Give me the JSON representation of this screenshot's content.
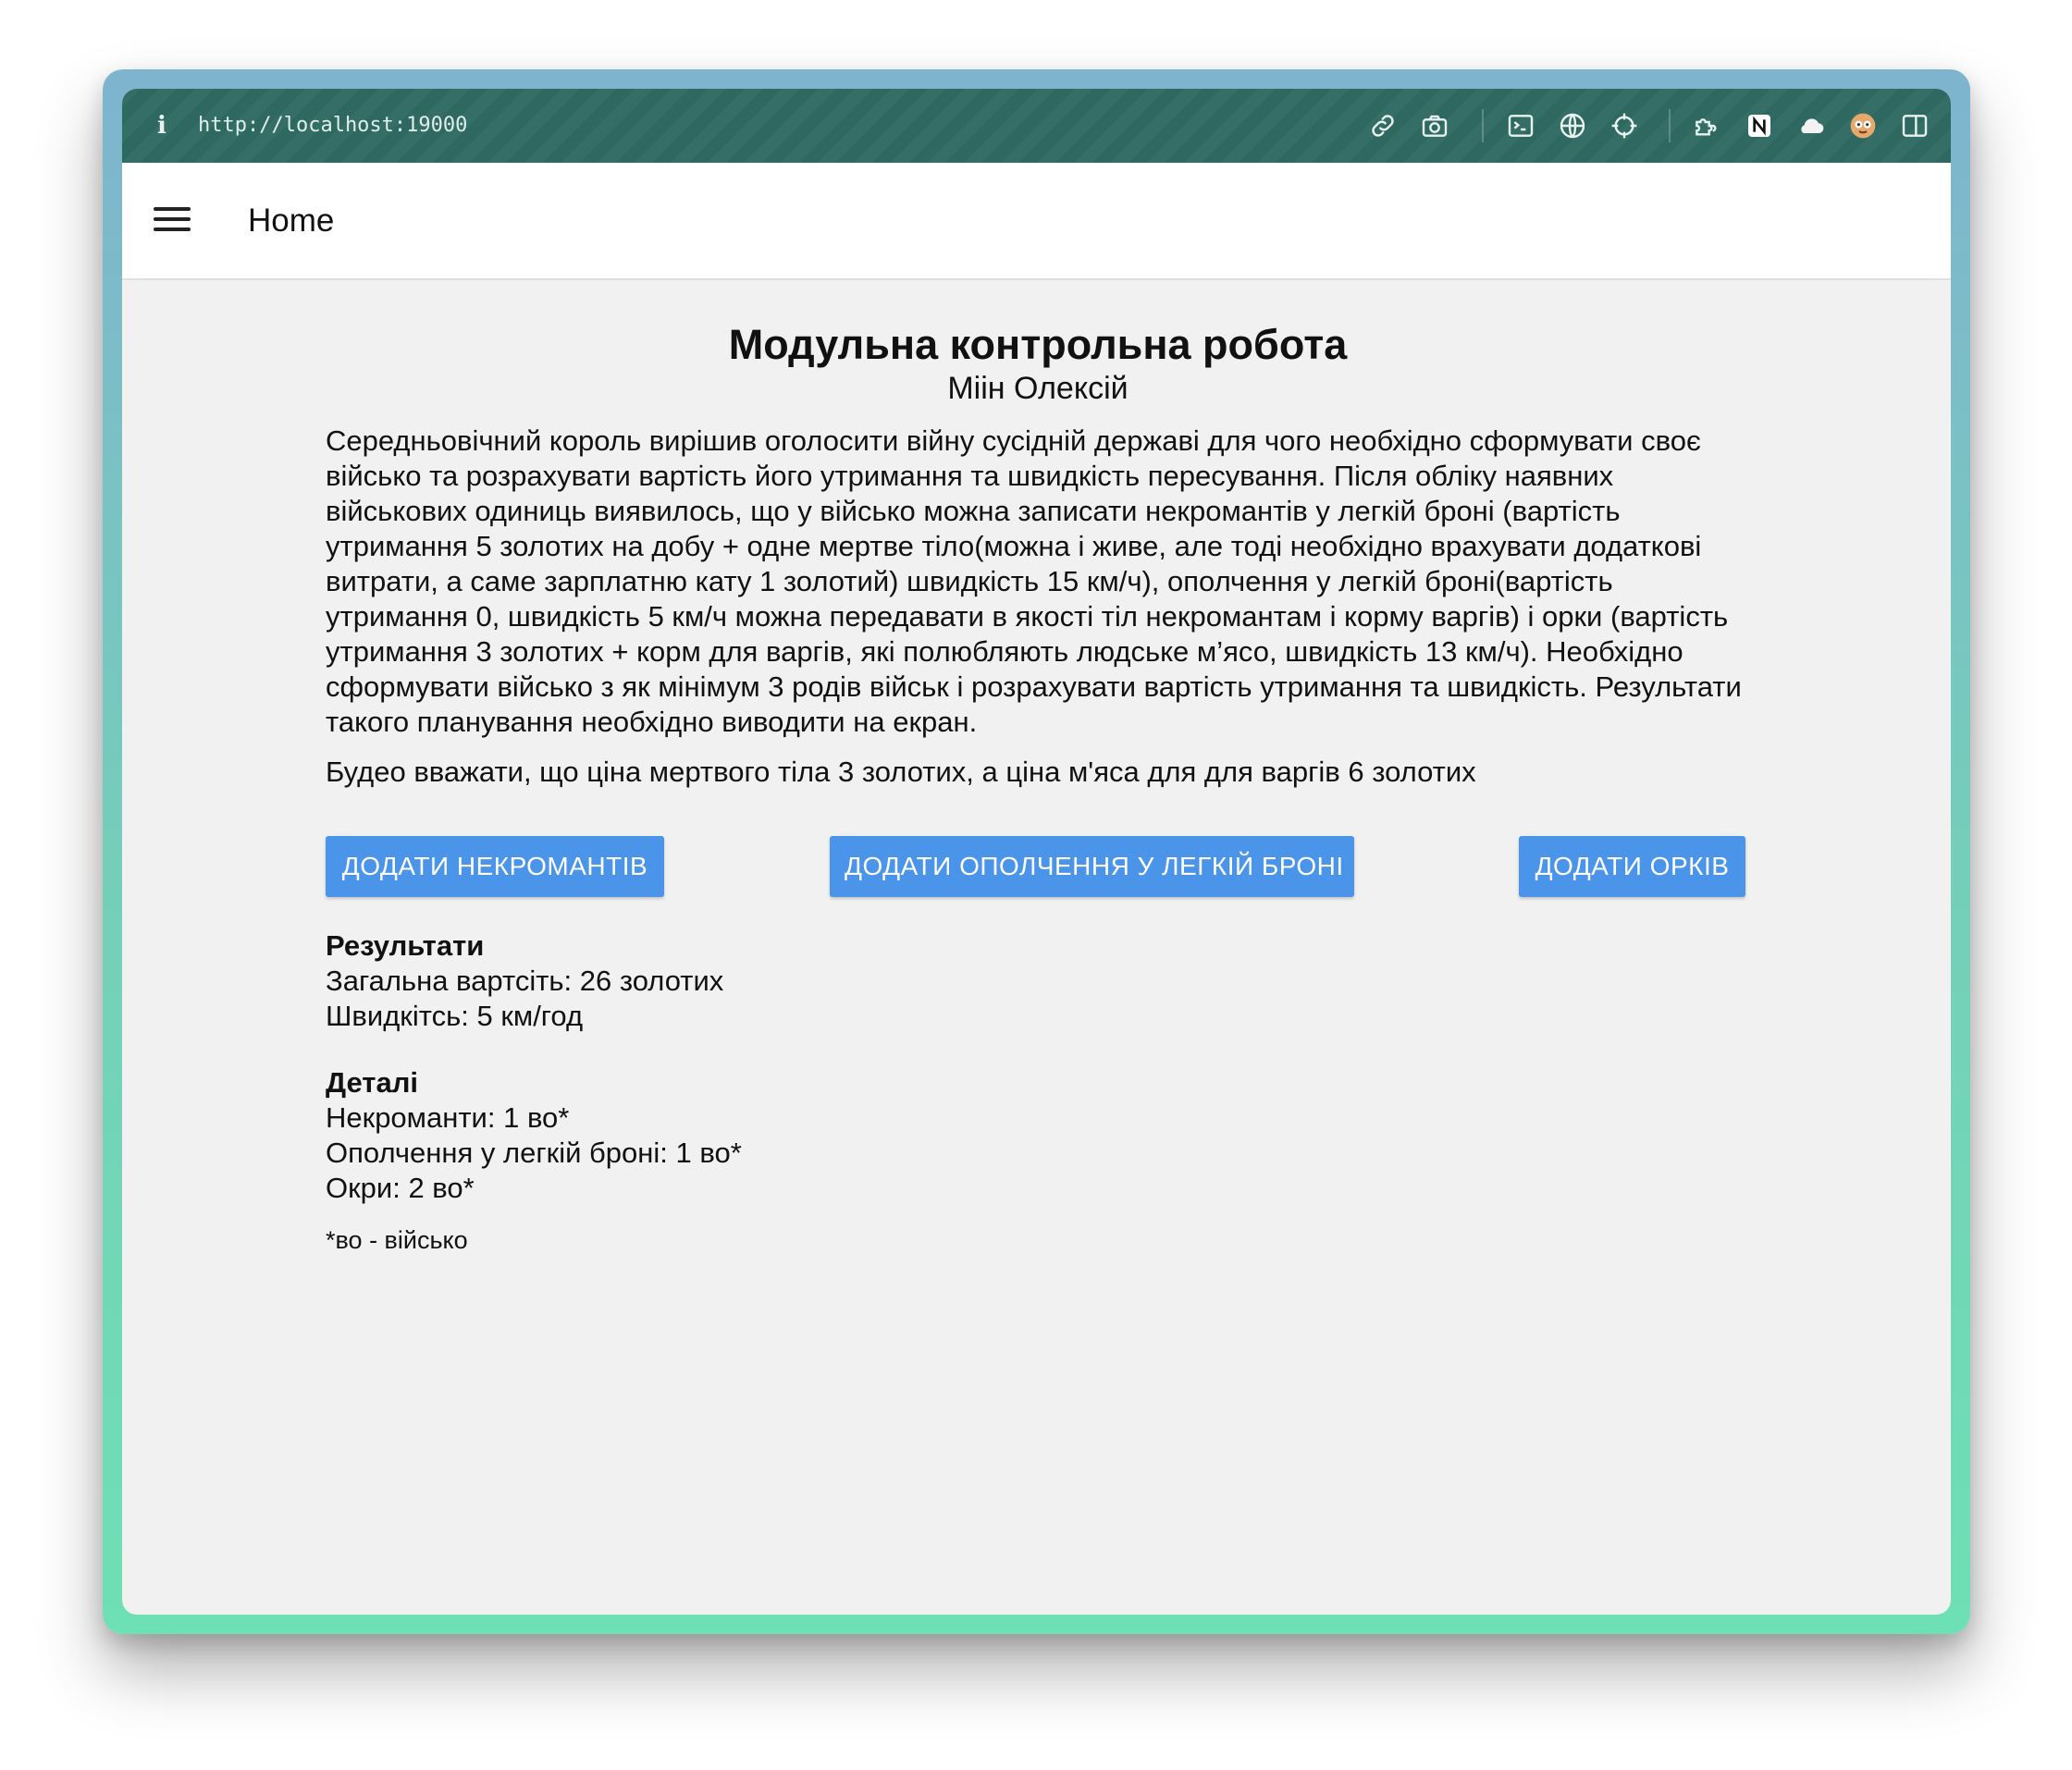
{
  "browser": {
    "url": "http://localhost:19000",
    "icons": [
      "info-icon",
      "link-icon",
      "camera-icon",
      "terminal-icon",
      "globe-icon",
      "crosshair-icon",
      "puzzle-icon",
      "notion-icon",
      "cloud-icon",
      "avatar-icon",
      "sidebar-icon"
    ]
  },
  "appbar": {
    "title": "Home"
  },
  "main": {
    "title": "Модульна контрольна робота",
    "author": "Міін Олексій",
    "task": "Середньовічний король вирішив оголосити війну сусідній державі для чого необхідно сформувати своє військо та розрахувати вартість його утримання та швидкість пересування. Після обліку наявних військових одиниць виявилось, що у військо можна записати некромантів у легкій броні (вартість утримання 5 золотих на добу + одне мертве тіло(можна і живе, але тоді необхідно врахувати додаткові витрати, а саме зарплатню кату 1 золотий) швидкість 15 км/ч), ополчення у легкій броні(вартість утримання 0, швидкість 5 км/ч можна передавати в якості тіл некромантам і корму варгів) і орки (вартість утримання 3 золотих + корм для варгів, які полюбляють людське м’ясо, швидкість 13 км/ч). Необхідно сформувати військо з як мінімум 3 родів військ і розрахувати вартість утримання та швидкість. Результати такого планування необхідно виводити на екран.",
    "note": "Будео вважати, що ціна мертвого тіла 3 золотих, а ціна м'яса для для варгів 6 золотих",
    "buttons": {
      "add_necromancers": "ДОДАТИ НЕКРОМАНТІВ",
      "add_militia": "ДОДАТИ ОПОЛЧЕННЯ У ЛЕГКІЙ БРОНІ",
      "add_orcs": "ДОДАТИ ОРКІВ"
    },
    "results": {
      "heading": "Результати",
      "total_cost": "Загальна вартсіть: 26 золотих",
      "speed": "Швидкітсь: 5 км/год"
    },
    "details": {
      "heading": "Деталі",
      "necromancers": "Некроманти: 1 во*",
      "militia": "Ополчення у легкій броні: 1 во*",
      "orcs": "Окри: 2 во*"
    },
    "footnote": "*во - військо"
  }
}
